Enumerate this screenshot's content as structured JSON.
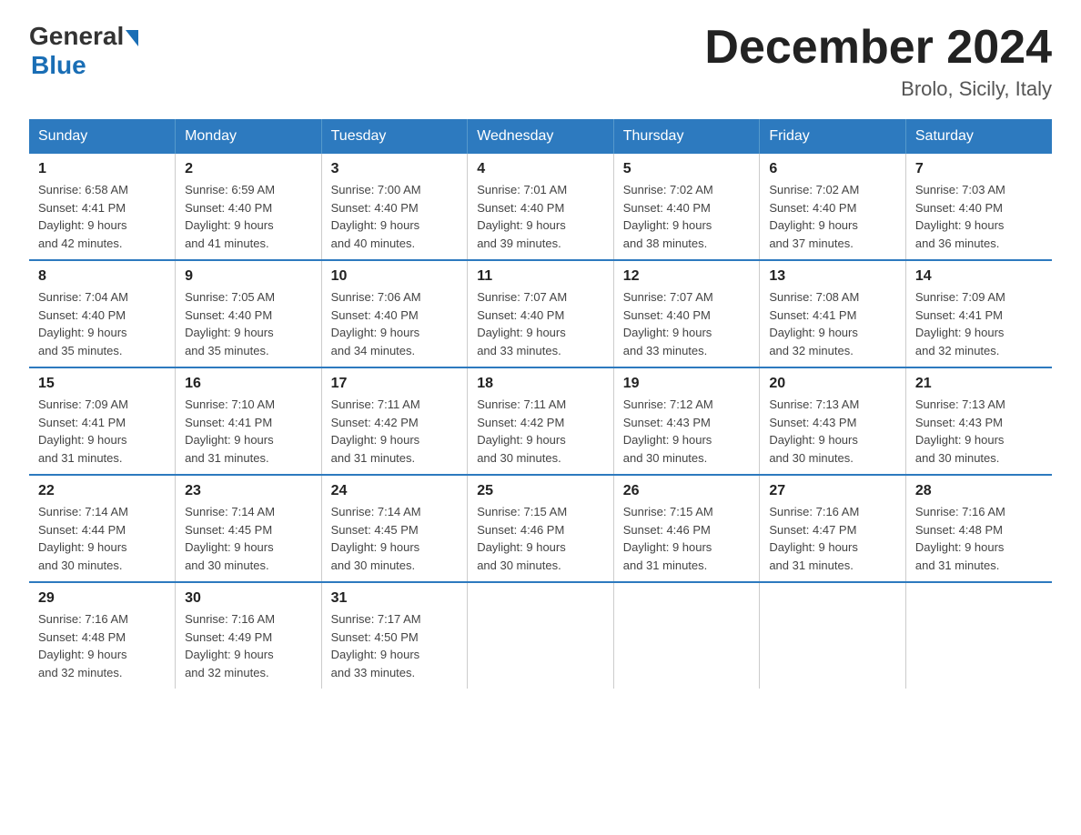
{
  "logo": {
    "general": "General",
    "blue": "Blue"
  },
  "title": "December 2024",
  "location": "Brolo, Sicily, Italy",
  "days_of_week": [
    "Sunday",
    "Monday",
    "Tuesday",
    "Wednesday",
    "Thursday",
    "Friday",
    "Saturday"
  ],
  "weeks": [
    [
      {
        "day": "1",
        "sunrise": "6:58 AM",
        "sunset": "4:41 PM",
        "daylight": "9 hours and 42 minutes."
      },
      {
        "day": "2",
        "sunrise": "6:59 AM",
        "sunset": "4:40 PM",
        "daylight": "9 hours and 41 minutes."
      },
      {
        "day": "3",
        "sunrise": "7:00 AM",
        "sunset": "4:40 PM",
        "daylight": "9 hours and 40 minutes."
      },
      {
        "day": "4",
        "sunrise": "7:01 AM",
        "sunset": "4:40 PM",
        "daylight": "9 hours and 39 minutes."
      },
      {
        "day": "5",
        "sunrise": "7:02 AM",
        "sunset": "4:40 PM",
        "daylight": "9 hours and 38 minutes."
      },
      {
        "day": "6",
        "sunrise": "7:02 AM",
        "sunset": "4:40 PM",
        "daylight": "9 hours and 37 minutes."
      },
      {
        "day": "7",
        "sunrise": "7:03 AM",
        "sunset": "4:40 PM",
        "daylight": "9 hours and 36 minutes."
      }
    ],
    [
      {
        "day": "8",
        "sunrise": "7:04 AM",
        "sunset": "4:40 PM",
        "daylight": "9 hours and 35 minutes."
      },
      {
        "day": "9",
        "sunrise": "7:05 AM",
        "sunset": "4:40 PM",
        "daylight": "9 hours and 35 minutes."
      },
      {
        "day": "10",
        "sunrise": "7:06 AM",
        "sunset": "4:40 PM",
        "daylight": "9 hours and 34 minutes."
      },
      {
        "day": "11",
        "sunrise": "7:07 AM",
        "sunset": "4:40 PM",
        "daylight": "9 hours and 33 minutes."
      },
      {
        "day": "12",
        "sunrise": "7:07 AM",
        "sunset": "4:40 PM",
        "daylight": "9 hours and 33 minutes."
      },
      {
        "day": "13",
        "sunrise": "7:08 AM",
        "sunset": "4:41 PM",
        "daylight": "9 hours and 32 minutes."
      },
      {
        "day": "14",
        "sunrise": "7:09 AM",
        "sunset": "4:41 PM",
        "daylight": "9 hours and 32 minutes."
      }
    ],
    [
      {
        "day": "15",
        "sunrise": "7:09 AM",
        "sunset": "4:41 PM",
        "daylight": "9 hours and 31 minutes."
      },
      {
        "day": "16",
        "sunrise": "7:10 AM",
        "sunset": "4:41 PM",
        "daylight": "9 hours and 31 minutes."
      },
      {
        "day": "17",
        "sunrise": "7:11 AM",
        "sunset": "4:42 PM",
        "daylight": "9 hours and 31 minutes."
      },
      {
        "day": "18",
        "sunrise": "7:11 AM",
        "sunset": "4:42 PM",
        "daylight": "9 hours and 30 minutes."
      },
      {
        "day": "19",
        "sunrise": "7:12 AM",
        "sunset": "4:43 PM",
        "daylight": "9 hours and 30 minutes."
      },
      {
        "day": "20",
        "sunrise": "7:13 AM",
        "sunset": "4:43 PM",
        "daylight": "9 hours and 30 minutes."
      },
      {
        "day": "21",
        "sunrise": "7:13 AM",
        "sunset": "4:43 PM",
        "daylight": "9 hours and 30 minutes."
      }
    ],
    [
      {
        "day": "22",
        "sunrise": "7:14 AM",
        "sunset": "4:44 PM",
        "daylight": "9 hours and 30 minutes."
      },
      {
        "day": "23",
        "sunrise": "7:14 AM",
        "sunset": "4:45 PM",
        "daylight": "9 hours and 30 minutes."
      },
      {
        "day": "24",
        "sunrise": "7:14 AM",
        "sunset": "4:45 PM",
        "daylight": "9 hours and 30 minutes."
      },
      {
        "day": "25",
        "sunrise": "7:15 AM",
        "sunset": "4:46 PM",
        "daylight": "9 hours and 30 minutes."
      },
      {
        "day": "26",
        "sunrise": "7:15 AM",
        "sunset": "4:46 PM",
        "daylight": "9 hours and 31 minutes."
      },
      {
        "day": "27",
        "sunrise": "7:16 AM",
        "sunset": "4:47 PM",
        "daylight": "9 hours and 31 minutes."
      },
      {
        "day": "28",
        "sunrise": "7:16 AM",
        "sunset": "4:48 PM",
        "daylight": "9 hours and 31 minutes."
      }
    ],
    [
      {
        "day": "29",
        "sunrise": "7:16 AM",
        "sunset": "4:48 PM",
        "daylight": "9 hours and 32 minutes."
      },
      {
        "day": "30",
        "sunrise": "7:16 AM",
        "sunset": "4:49 PM",
        "daylight": "9 hours and 32 minutes."
      },
      {
        "day": "31",
        "sunrise": "7:17 AM",
        "sunset": "4:50 PM",
        "daylight": "9 hours and 33 minutes."
      },
      null,
      null,
      null,
      null
    ]
  ],
  "labels": {
    "sunrise": "Sunrise:",
    "sunset": "Sunset:",
    "daylight": "Daylight:"
  }
}
